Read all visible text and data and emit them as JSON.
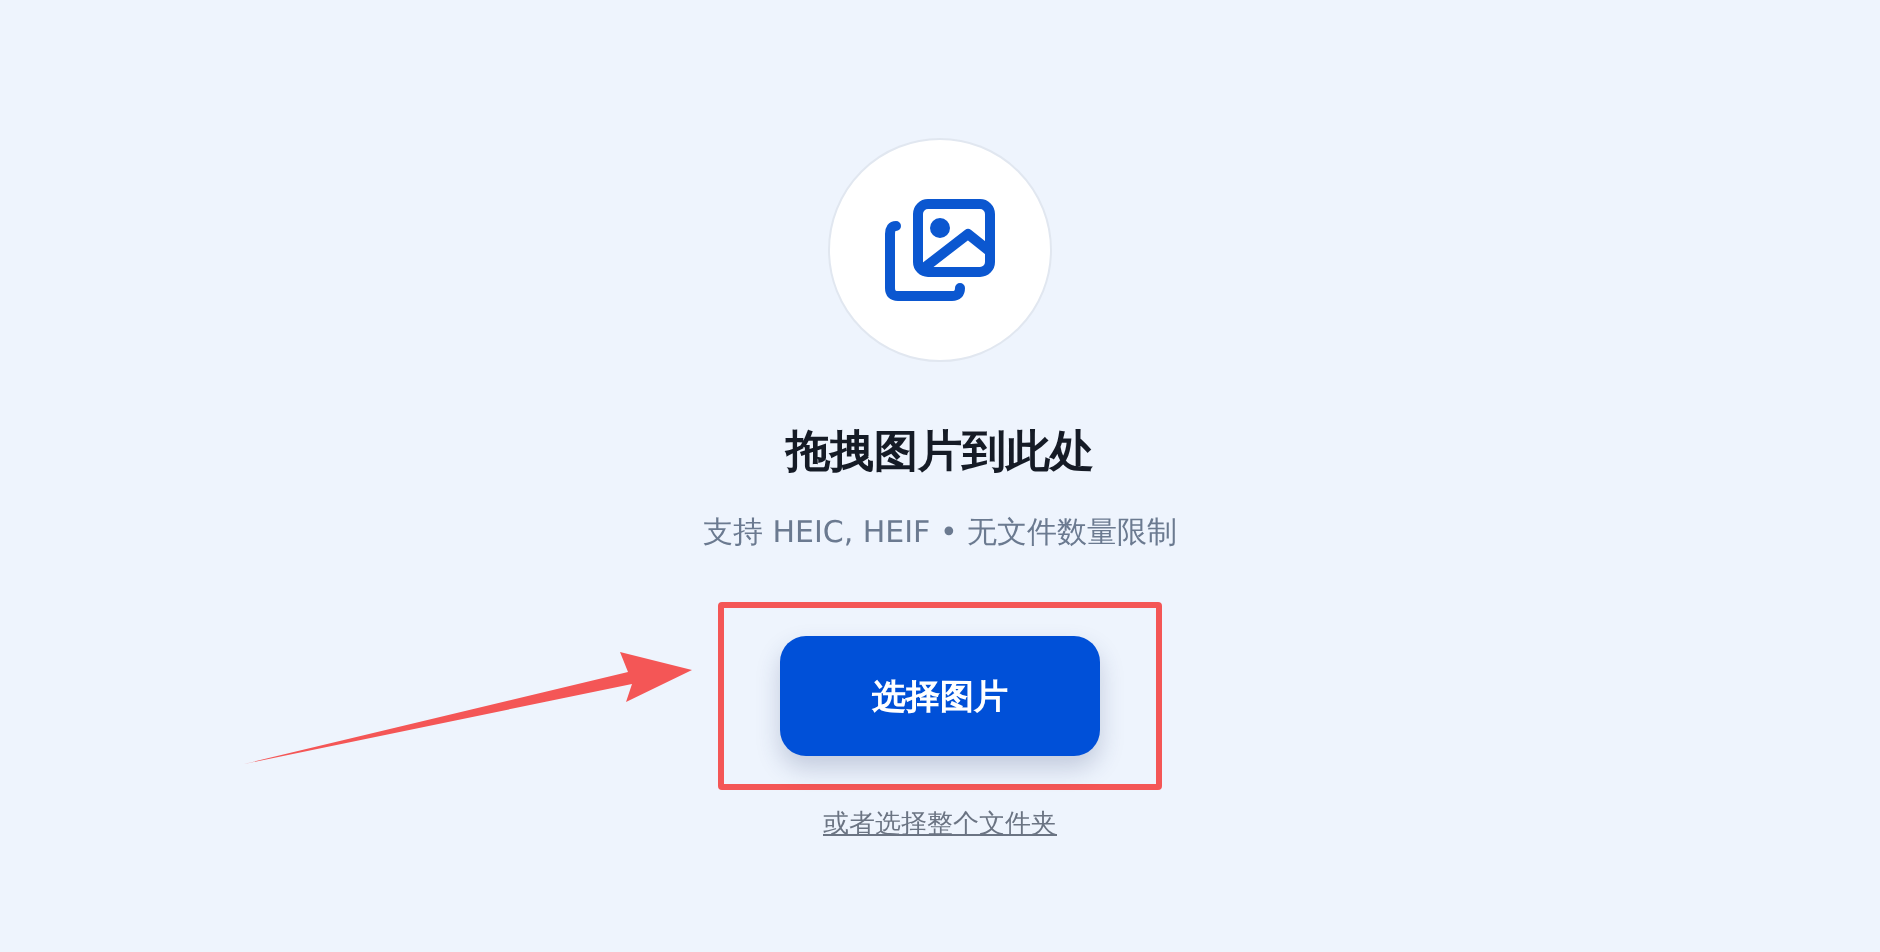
{
  "upload": {
    "title": "拖拽图片到此处",
    "subtitle": "支持 HEIC, HEIF • 无文件数量限制",
    "button": "选择图片",
    "folder_link": "或者选择整个文件夹"
  },
  "annotations": {
    "highlight_box": true,
    "arrow": true
  }
}
